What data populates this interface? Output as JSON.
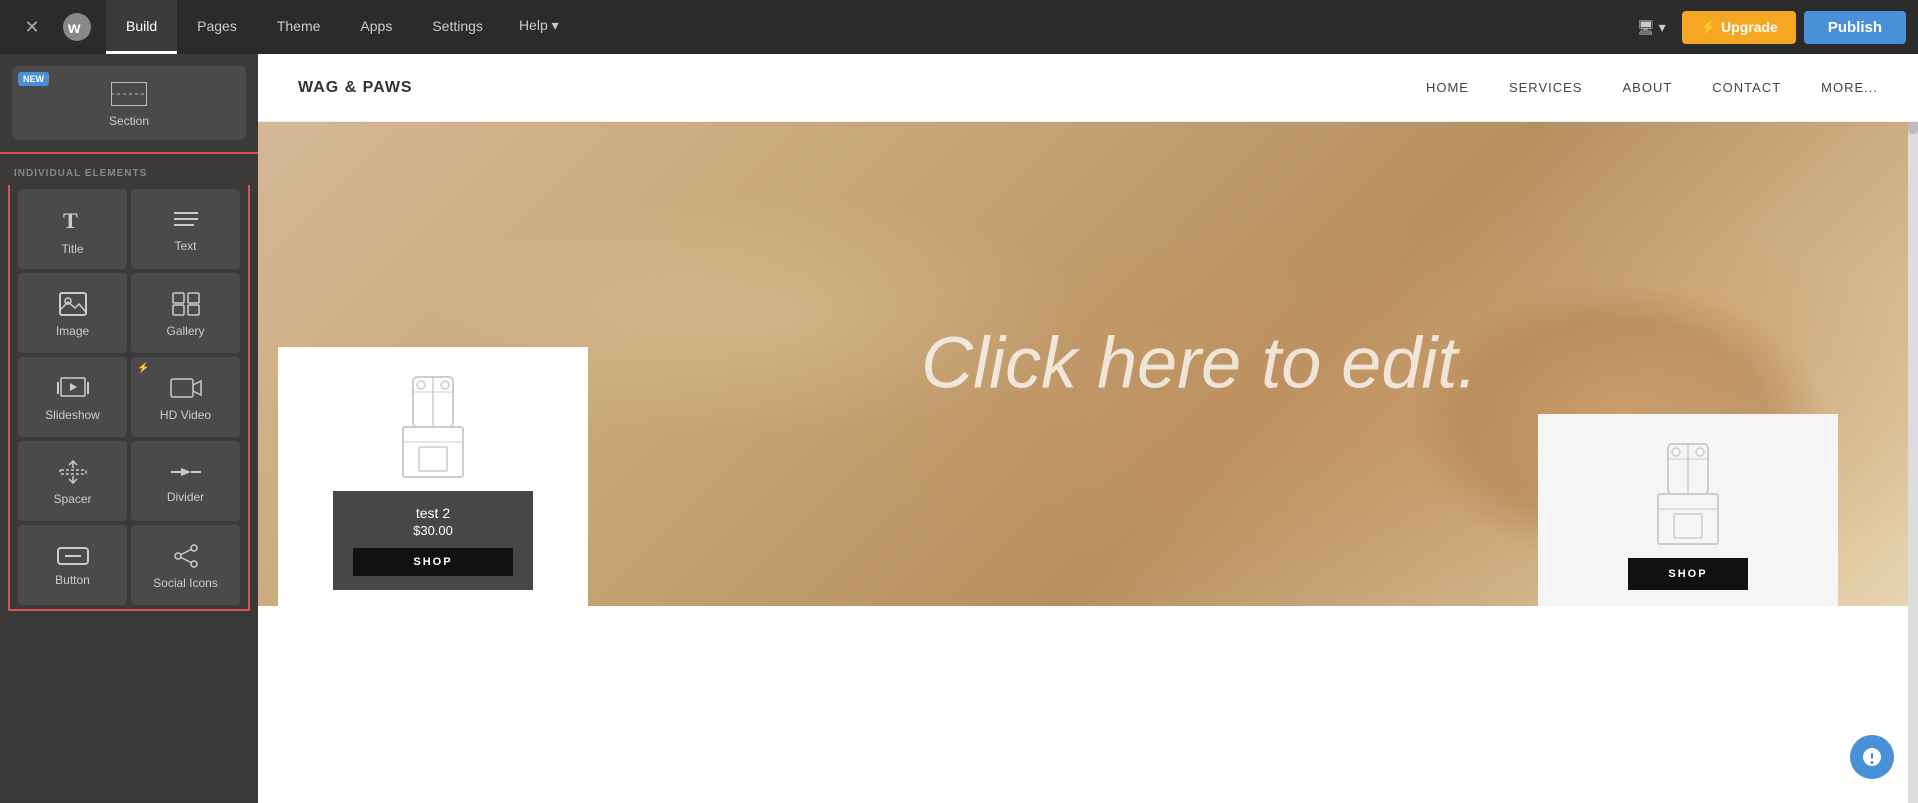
{
  "topnav": {
    "close_label": "×",
    "tabs": [
      {
        "label": "Build",
        "active": true
      },
      {
        "label": "Pages",
        "active": false
      },
      {
        "label": "Theme",
        "active": false
      },
      {
        "label": "Apps",
        "active": false
      },
      {
        "label": "Settings",
        "active": false
      },
      {
        "label": "Help ▾",
        "active": false
      }
    ],
    "device_label": "🖥 ▾",
    "upgrade_label": "⚡ Upgrade",
    "publish_label": "Publish"
  },
  "sidebar": {
    "section_label": "Section",
    "new_badge": "NEW",
    "individual_elements_label": "INDIVIDUAL ELEMENTS",
    "elements": [
      {
        "id": "title",
        "label": "Title",
        "icon": "T"
      },
      {
        "id": "text",
        "label": "Text",
        "icon": "≡"
      },
      {
        "id": "image",
        "label": "Image",
        "icon": "img"
      },
      {
        "id": "gallery",
        "label": "Gallery",
        "icon": "gallery"
      },
      {
        "id": "slideshow",
        "label": "Slideshow",
        "icon": "slideshow"
      },
      {
        "id": "hd-video",
        "label": "HD Video",
        "icon": "video",
        "lightning": true
      },
      {
        "id": "spacer",
        "label": "Spacer",
        "icon": "spacer"
      },
      {
        "id": "divider",
        "label": "Divider",
        "icon": "divider"
      },
      {
        "id": "button",
        "label": "Button",
        "icon": "button"
      },
      {
        "id": "social-icons",
        "label": "Social Icons",
        "icon": "share"
      }
    ]
  },
  "site": {
    "logo": "WAG & PAWS",
    "nav": [
      "HOME",
      "SERVICES",
      "ABOUT",
      "CONTACT",
      "MORE..."
    ],
    "hero_title": "Click here to edit.",
    "product1": {
      "name": "test 2",
      "price": "$30.00",
      "shop_label": "SHOP"
    },
    "product2": {
      "shop_label": "SHOP"
    }
  }
}
